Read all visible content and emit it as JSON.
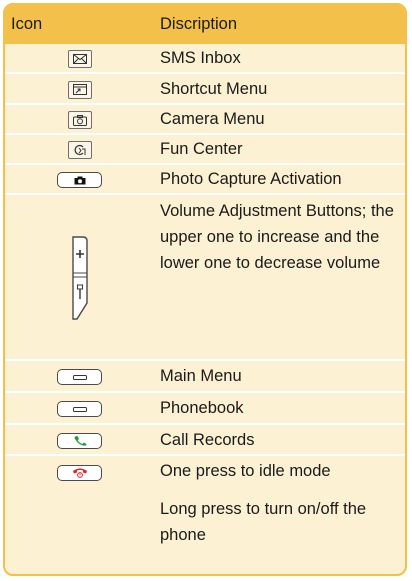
{
  "header": {
    "icon": "Icon",
    "description": "Discription"
  },
  "rows": [
    {
      "icon": "envelope-icon",
      "text": "SMS Inbox"
    },
    {
      "icon": "shortcut-icon",
      "text": "Shortcut Menu"
    },
    {
      "icon": "camera-icon",
      "text": "Camera Menu"
    },
    {
      "icon": "fun-center-icon",
      "text": "Fun Center"
    },
    {
      "icon": "camera-key-icon",
      "text": "Photo Capture Activation"
    },
    {
      "icon": "volume-buttons-icon",
      "text": "Volume Adjustment Buttons; the upper one to increase and the lower one to decrease volume"
    },
    {
      "icon": "left-soft-key-icon",
      "text": "Main Menu"
    },
    {
      "icon": "right-soft-key-icon",
      "text": "Phonebook"
    },
    {
      "icon": "call-key-icon",
      "text": "Call Records"
    },
    {
      "icon": "end-key-icon",
      "text": "One press to idle mode"
    },
    {
      "icon": "",
      "text": "Long press to turn on/off the phone"
    }
  ],
  "colors": {
    "header": "#f3c14a",
    "body": "#fdf1d3",
    "call_green": "#1e9e3a",
    "end_red": "#d42a2a"
  }
}
